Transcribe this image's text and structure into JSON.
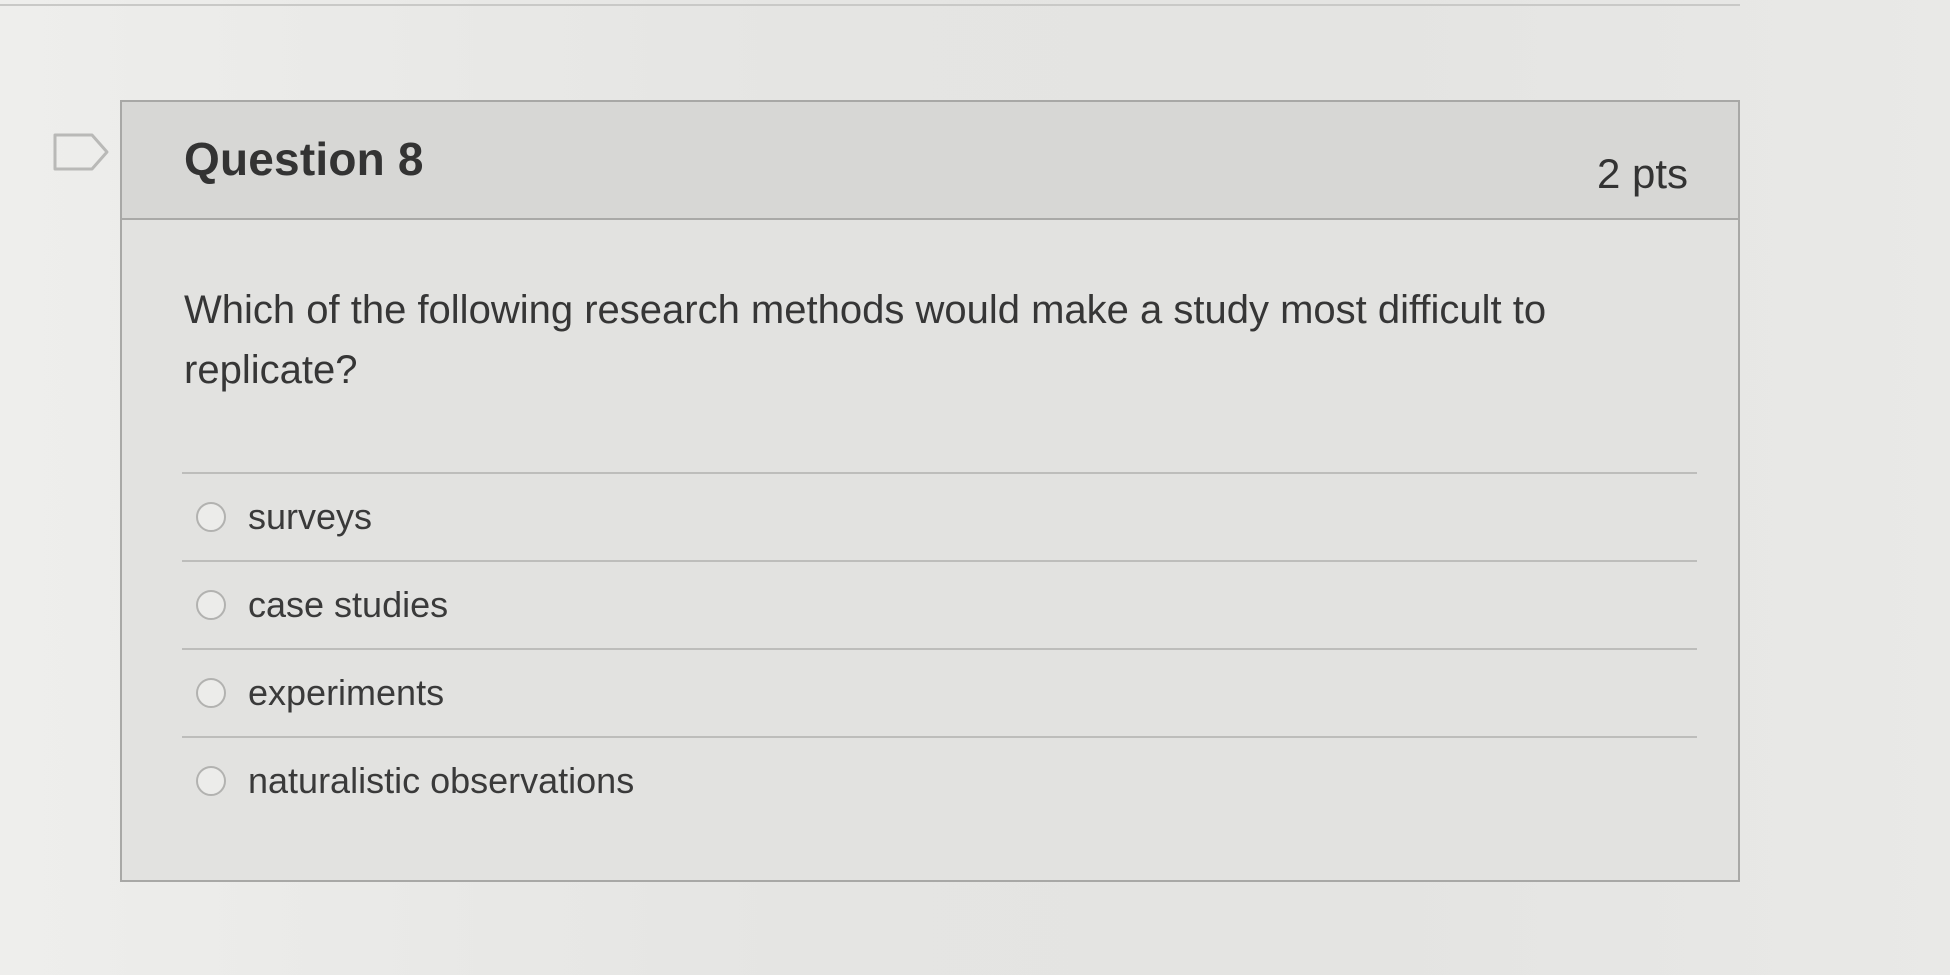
{
  "question": {
    "title": "Question 8",
    "points": "2 pts",
    "text": "Which of the following research methods would make a study most difficult to replicate?",
    "options": [
      {
        "label": "surveys",
        "selected": false
      },
      {
        "label": "case studies",
        "selected": false
      },
      {
        "label": "experiments",
        "selected": false
      },
      {
        "label": "naturalistic observations",
        "selected": false
      }
    ]
  },
  "icons": {
    "flag": "flag-outline-icon",
    "radio": "radio-unselected-icon"
  },
  "colors": {
    "header_bg": "#d7d7d5",
    "card_bg": "#e2e2e0",
    "border": "#a8a8a6",
    "text": "#333333"
  }
}
